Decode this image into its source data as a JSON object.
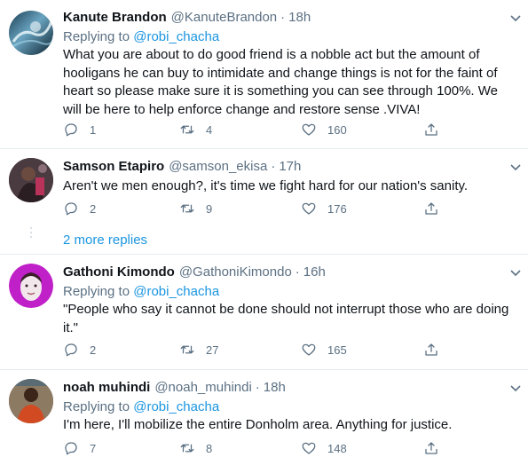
{
  "tweets": [
    {
      "name": "Kanute Brandon",
      "handle": "@KanuteBrandon",
      "time": "18h",
      "replying_label": "Replying to",
      "replying_to": "@robi_chacha",
      "text": "What you are about to do good friend is a nobble act but the amount of hooligans he can buy to intimidate and change things is not for the faint of heart so please make sure it is something you can see through 100%. We will be here to help enforce change and restore sense .VIVA!",
      "replies": "1",
      "retweets": "4",
      "likes": "160"
    },
    {
      "name": "Samson Etapiro",
      "handle": "@samson_ekisa",
      "time": "17h",
      "text": "Aren't we men enough?, it's time we fight hard for our nation's sanity.",
      "replies": "2",
      "retweets": "9",
      "likes": "176"
    },
    {
      "name": "Gathoni Kimondo",
      "handle": "@GathoniKimondo",
      "time": "16h",
      "replying_label": "Replying to",
      "replying_to": "@robi_chacha",
      "text": "\"People who say it cannot be done should not interrupt those who are doing it.\"",
      "replies": "2",
      "retweets": "27",
      "likes": "165"
    },
    {
      "name": "noah muhindi",
      "handle": "@noah_muhindi",
      "time": "18h",
      "replying_label": "Replying to",
      "replying_to": "@robi_chacha",
      "text": "I'm here, I'll mobilize the entire Donholm area. Anything for justice.",
      "replies": "7",
      "retweets": "8",
      "likes": "148"
    }
  ],
  "more_replies": "2 more replies",
  "dot": "·",
  "colors": {
    "text": "#0f1419",
    "secondary": "#5b7083",
    "link": "#1b95e0",
    "divider": "#e6ecf0"
  },
  "icons": {
    "reply": "reply-icon",
    "retweet": "retweet-icon",
    "like": "heart-icon",
    "share": "share-icon",
    "caret": "chevron-down-icon"
  }
}
